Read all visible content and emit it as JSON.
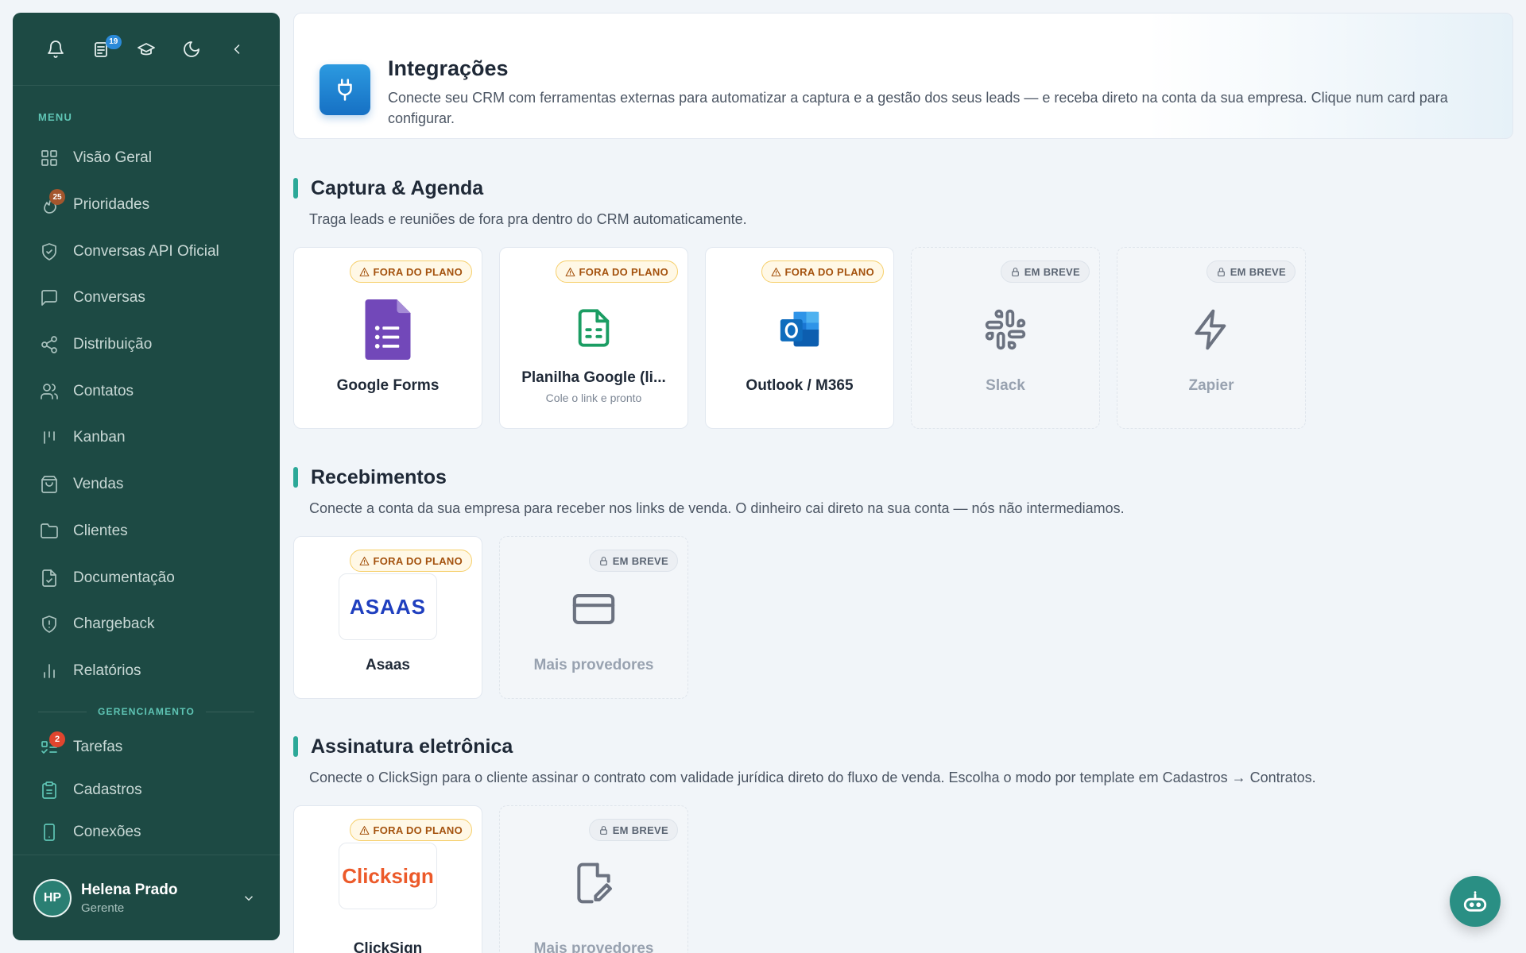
{
  "sidebar": {
    "top_badge": "19",
    "menu_label": "MENU",
    "items": [
      {
        "label": "Visão Geral",
        "icon": "dashboard-icon"
      },
      {
        "label": "Prioridades",
        "icon": "fire-icon",
        "badge": "25"
      },
      {
        "label": "Conversas API Oficial",
        "icon": "shield-check-icon"
      },
      {
        "label": "Conversas",
        "icon": "chat-icon"
      },
      {
        "label": "Distribuição",
        "icon": "share-icon"
      },
      {
        "label": "Contatos",
        "icon": "users-icon"
      },
      {
        "label": "Kanban",
        "icon": "kanban-icon"
      },
      {
        "label": "Vendas",
        "icon": "shopping-bag-icon"
      },
      {
        "label": "Clientes",
        "icon": "folder-icon"
      },
      {
        "label": "Documentação",
        "icon": "file-check-icon"
      },
      {
        "label": "Chargeback",
        "icon": "shield-alert-icon"
      },
      {
        "label": "Relatórios",
        "icon": "bar-chart-icon"
      }
    ],
    "manage_label": "GERENCIAMENTO",
    "manage_items": [
      {
        "label": "Tarefas",
        "icon": "tasks-icon",
        "badge": "2"
      },
      {
        "label": "Cadastros",
        "icon": "clipboard-icon"
      },
      {
        "label": "Conexões",
        "icon": "phone-icon"
      }
    ],
    "user": {
      "initials": "HP",
      "name": "Helena Prado",
      "role": "Gerente"
    }
  },
  "header": {
    "title": "Integrações",
    "description": "Conecte seu CRM com ferramentas externas para automatizar a captura e a gestão dos seus leads — e receba direto na conta da sua empresa. Clique num card para configurar."
  },
  "sections": [
    {
      "title": "Captura & Agenda",
      "description": "Traga leads e reuniões de fora pra dentro do CRM automaticamente.",
      "cards": [
        {
          "name": "Google Forms",
          "status": "FORA DO PLANO"
        },
        {
          "name": "Planilha Google (li...",
          "sub": "Cole o link e pronto",
          "status": "FORA DO PLANO"
        },
        {
          "name": "Outlook / M365",
          "status": "FORA DO PLANO"
        },
        {
          "name": "Slack",
          "status": "EM BREVE"
        },
        {
          "name": "Zapier",
          "status": "EM BREVE"
        }
      ]
    },
    {
      "title": "Recebimentos",
      "description": "Conecte a conta da sua empresa para receber nos links de venda. O dinheiro cai direto na sua conta — nós não intermediamos.",
      "cards": [
        {
          "name": "Asaas",
          "status": "FORA DO PLANO",
          "logo_text": "ASAAS"
        },
        {
          "name": "Mais provedores",
          "status": "EM BREVE"
        }
      ]
    },
    {
      "title": "Assinatura eletrônica",
      "description": "Conecte o ClickSign para o cliente assinar o contrato com validade jurídica direto do fluxo de venda. Escolha o modo por template em Cadastros → Contratos.",
      "cards": [
        {
          "name": "ClickSign",
          "status": "FORA DO PLANO",
          "logo_text": "Clicksign"
        },
        {
          "name": "Mais provedores",
          "status": "EM BREVE"
        }
      ]
    }
  ],
  "colors": {
    "sidebar": "#1d4a44",
    "accent": "#2ca898",
    "warning": "#a4520e"
  }
}
